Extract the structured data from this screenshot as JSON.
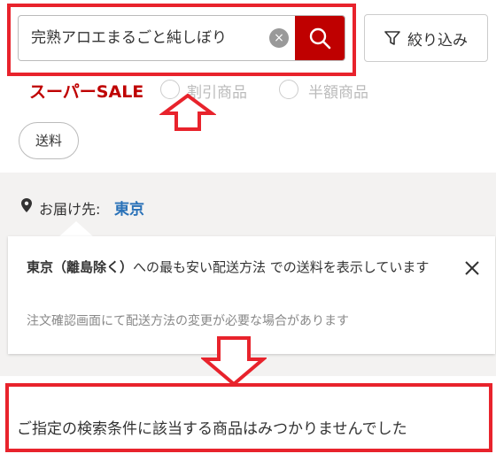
{
  "search": {
    "query": "完熟アロエまるごと純しぼり",
    "clear_glyph": "×"
  },
  "filter": {
    "label": "絞り込み"
  },
  "sale": {
    "label": "スーパーSALE"
  },
  "options": [
    {
      "label": "割引商品"
    },
    {
      "label": "半額商品"
    }
  ],
  "tags": [
    {
      "label": "送料"
    }
  ],
  "delivery": {
    "label": "お届け先:",
    "value": "東京"
  },
  "popup": {
    "region": "東京（離島除く）",
    "message": "への最も安い配送方法 での送料を表示しています",
    "note": "注文確認画面にて配送方法の変更が必要な場合があります"
  },
  "results": {
    "message": "ご指定の検索条件に該当する商品はみつかりませんでした"
  },
  "colors": {
    "brand": "#bf0000",
    "annotation": "#e8232c",
    "link": "#2a72b8"
  }
}
